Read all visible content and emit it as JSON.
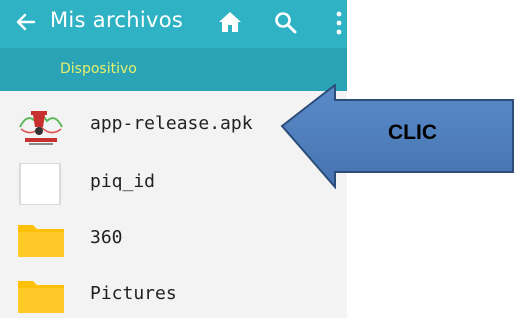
{
  "header": {
    "title": "Mis archivos",
    "back_icon": "arrow-left-icon",
    "home_icon": "home-icon",
    "search_icon": "search-icon",
    "more_icon": "more-vertical-icon",
    "breadcrumb": "Dispositivo"
  },
  "files": [
    {
      "name": "app-release.apk",
      "icon": "apk-app-icon"
    },
    {
      "name": "piq_id",
      "icon": "file-icon"
    },
    {
      "name": "360",
      "icon": "folder-icon"
    },
    {
      "name": "Pictures",
      "icon": "folder-icon"
    }
  ],
  "callout": {
    "label": "CLIC"
  },
  "colors": {
    "appbar": "#2fb2c4",
    "breadcrumb_bar": "#29a3b5",
    "breadcrumb_text": "#e6ef6a",
    "folder": "#ffc107",
    "arrow": "#4f81bd"
  }
}
